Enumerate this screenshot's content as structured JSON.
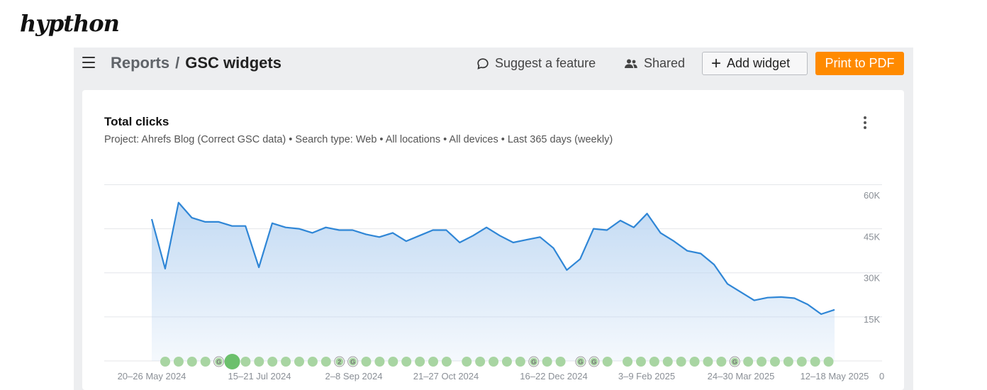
{
  "brand": {
    "logo_text": "hypthon"
  },
  "topbar": {
    "menu_icon": "hamburger-icon",
    "breadcrumb_parent": "Reports",
    "breadcrumb_separator": "/",
    "breadcrumb_current": "GSC widgets",
    "suggest_label": "Suggest a feature",
    "suggest_icon": "speech-bubble-icon",
    "shared_label": "Shared",
    "shared_icon": "users-icon",
    "add_widget_label": "Add widget",
    "print_label": "Print to PDF",
    "print_color": "#ff8a00"
  },
  "widget": {
    "title": "Total clicks",
    "subtitle": "Project: Ahrefs Blog (Correct GSC data)  •  Search type: Web  •  All locations  •  All devices  •  Last 365 days (weekly)",
    "more_icon": "vertical-ellipsis-icon"
  },
  "chart_data": {
    "type": "area",
    "title": "Total clicks",
    "y_ticks": [
      "60K",
      "45K",
      "30K",
      "15K",
      "0"
    ],
    "ylim": [
      0,
      60000
    ],
    "x_tick_labels": [
      "20–26 May 2024",
      "15–21 Jul 2024",
      "2–8 Sep 2024",
      "21–27 Oct 2024",
      "16–22 Dec 2024",
      "3–9 Feb 2025",
      "24–30 Mar 2025",
      "12–18 May 2025"
    ],
    "grid": true,
    "line_color": "#2f86d6",
    "fill_color": "#bcd6f2",
    "series": [
      {
        "values": [
          51500,
          33500,
          57500,
          52000,
          50500,
          50500,
          49000,
          49000,
          34000,
          50000,
          48500,
          48000,
          46500,
          48500,
          47500,
          47500,
          46000,
          45000,
          46500,
          43500,
          45500,
          47500,
          47500,
          43000,
          45500,
          48500,
          45500,
          43000,
          44000,
          45000,
          41000,
          33000,
          37000,
          48000,
          47500,
          51000,
          48500,
          53500,
          46500,
          43500,
          40000,
          39000,
          35000,
          28000,
          25000,
          22000,
          23000,
          23200,
          22800,
          20500,
          17000,
          18600
        ]
      }
    ],
    "annotations": {
      "marker_color": "#a8d5a2",
      "highlight_color": "#6cc06c",
      "highlight_index": 5,
      "google_update_indices": [
        4,
        14,
        28,
        32,
        33,
        44
      ],
      "numbered_markers": [
        {
          "index": 13,
          "label": "2"
        }
      ],
      "gap_indices": [
        22,
        31,
        35
      ],
      "google_label": "G"
    }
  }
}
